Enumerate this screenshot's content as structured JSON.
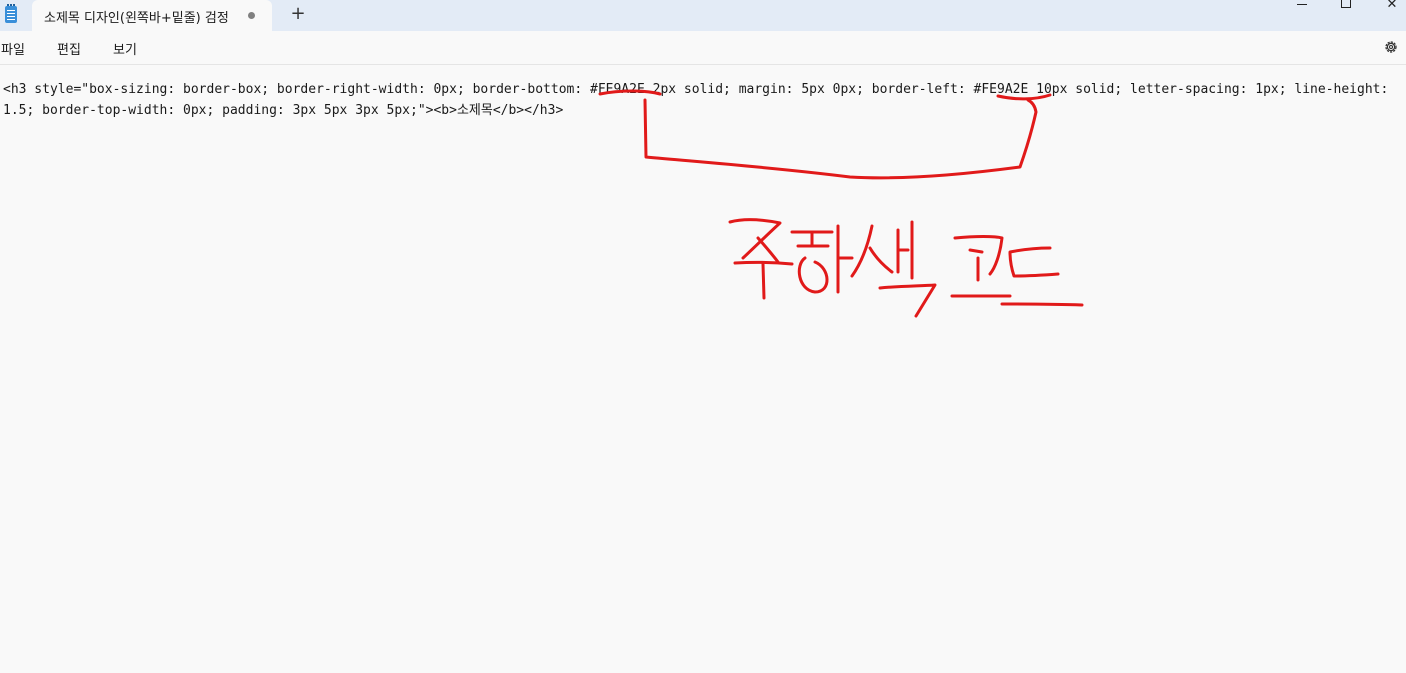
{
  "titlebar": {
    "tab_title": "소제목 디자인(왼쪽바+밑줄) 검정",
    "new_tab": "+",
    "close_glyph": "✕"
  },
  "menu": {
    "file": "파일",
    "edit": "편집",
    "view": "보기"
  },
  "editor": {
    "text": "<h3 style=\"box-sizing: border-box; border-right-width: 0px; border-bottom: #FE9A2E 2px solid; margin: 5px 0px; border-left: #FE9A2E 10px solid; letter-spacing: 1px; line-height: 1.5; border-top-width: 0px; padding: 3px 5px 3px 5px;\"><b>소제목</b></h3>"
  },
  "annotation": {
    "handwritten_text": "주황색 코드",
    "color": "#e11a1a"
  },
  "icons": {
    "app": "notepad-icon",
    "settings": "gear-icon"
  }
}
